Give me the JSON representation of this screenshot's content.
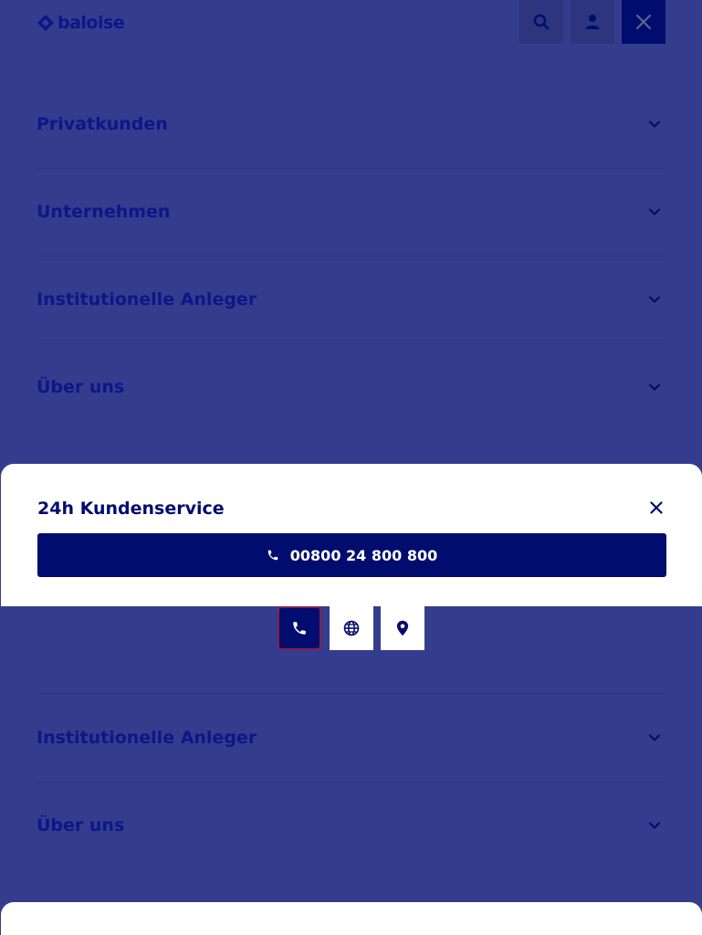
{
  "brand": {
    "name": "baloise"
  },
  "topbar": {
    "search_icon": "search-icon",
    "user_icon": "user-icon",
    "close_icon": "close-icon"
  },
  "menu": {
    "items": [
      {
        "label": "Privatkunden"
      },
      {
        "label": "Unternehmen"
      },
      {
        "label": "Institutionelle Anleger"
      },
      {
        "label": "Über uns"
      }
    ],
    "repeated_items": [
      {
        "label": "Institutionelle Anleger"
      },
      {
        "label": "Über uns"
      }
    ]
  },
  "service_panel": {
    "title": "24h Kundenservice",
    "phone_number": "00800 24 800 800"
  },
  "contact_tabs": [
    {
      "icon": "phone-icon",
      "active": true
    },
    {
      "icon": "globe-icon",
      "active": false
    },
    {
      "icon": "location-pin-icon",
      "active": false
    }
  ],
  "colors": {
    "overlay": "#343d8d",
    "primary": "#000d6e",
    "panel": "#ffffff",
    "active_outline": "#8a1e4c"
  }
}
